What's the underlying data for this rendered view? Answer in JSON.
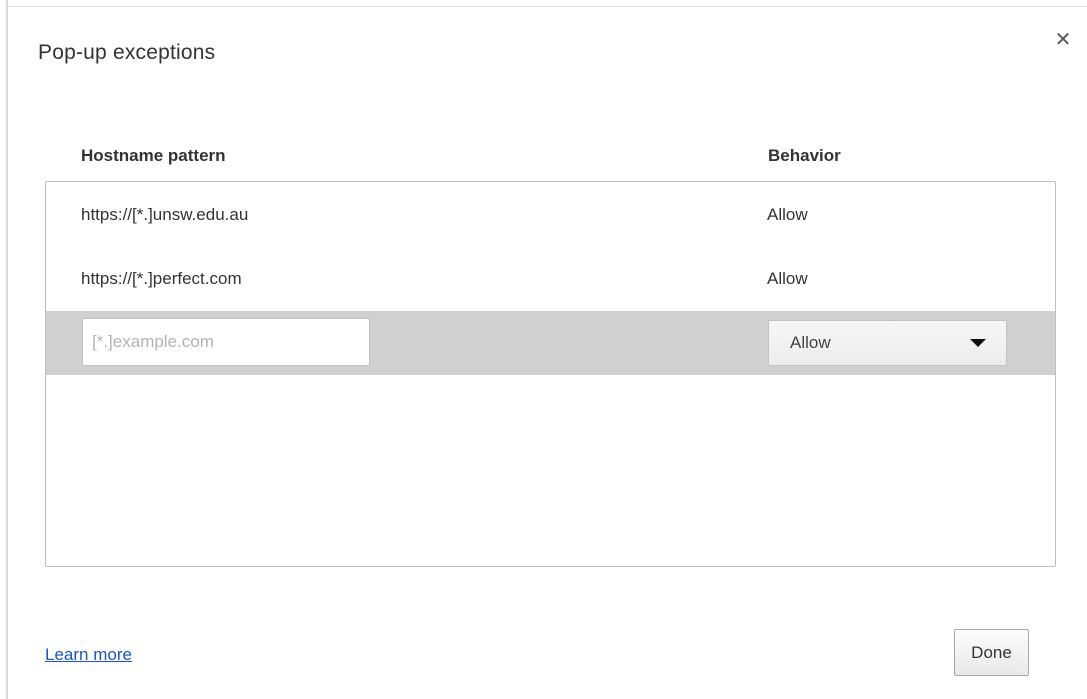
{
  "dialog": {
    "title": "Pop-up exceptions",
    "close_icon": "close-icon",
    "close_glyph": "✕"
  },
  "table": {
    "headers": {
      "hostname": "Hostname pattern",
      "behavior": "Behavior"
    },
    "rows": [
      {
        "hostname": "https://[*.]unsw.edu.au",
        "behavior": "Allow"
      },
      {
        "hostname": "https://[*.]perfect.com",
        "behavior": "Allow"
      }
    ],
    "new_entry": {
      "hostname_value": "",
      "hostname_placeholder": "[*.]example.com",
      "behavior_selected": "Allow"
    }
  },
  "footer": {
    "learn_more": "Learn more",
    "done": "Done"
  },
  "colors": {
    "link": "#1a55c9",
    "selected_row": "#d0d0d0",
    "border": "#bfbfbf"
  }
}
